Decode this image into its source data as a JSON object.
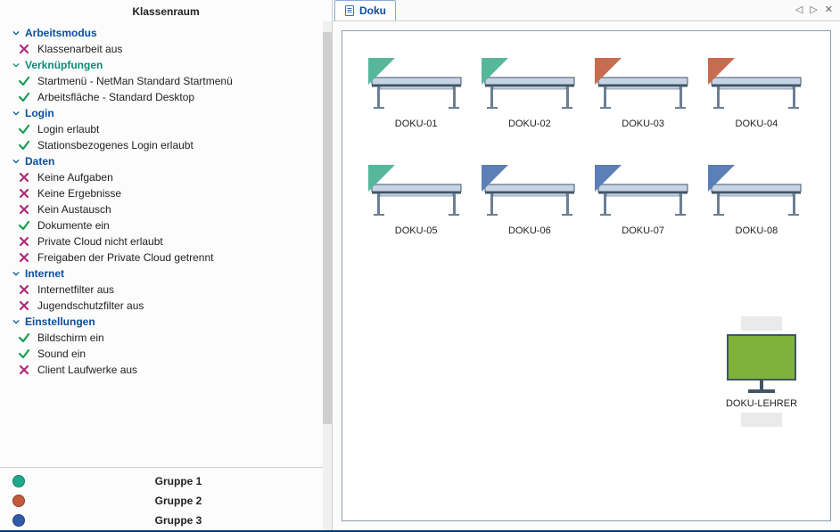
{
  "sidebar": {
    "title": "Klassenraum",
    "sections": [
      {
        "name": "Arbeitsmodus",
        "color": "blue",
        "items": [
          {
            "status": "off",
            "label": "Klassenarbeit aus"
          }
        ]
      },
      {
        "name": "Verknüpfungen",
        "color": "green",
        "items": [
          {
            "status": "on",
            "label": "Startmenü - NetMan Standard Startmenü"
          },
          {
            "status": "on",
            "label": "Arbeitsfläche - Standard Desktop"
          }
        ]
      },
      {
        "name": "Login",
        "color": "blue",
        "items": [
          {
            "status": "on",
            "label": "Login erlaubt"
          },
          {
            "status": "on",
            "label": "Stationsbezogenes Login erlaubt"
          }
        ]
      },
      {
        "name": "Daten",
        "color": "blue",
        "items": [
          {
            "status": "off",
            "label": "Keine Aufgaben"
          },
          {
            "status": "off",
            "label": "Keine Ergebnisse"
          },
          {
            "status": "off",
            "label": "Kein Austausch"
          },
          {
            "status": "on",
            "label": "Dokumente ein"
          },
          {
            "status": "off",
            "label": "Private Cloud nicht erlaubt"
          },
          {
            "status": "off",
            "label": "Freigaben der Private Cloud getrennt"
          }
        ]
      },
      {
        "name": "Internet",
        "color": "blue",
        "items": [
          {
            "status": "off",
            "label": "Internetfilter aus"
          },
          {
            "status": "off",
            "label": "Jugendschutzfilter aus"
          }
        ]
      },
      {
        "name": "Einstellungen",
        "color": "blue",
        "items": [
          {
            "status": "on",
            "label": "Bildschirm ein"
          },
          {
            "status": "on",
            "label": "Sound ein"
          },
          {
            "status": "off",
            "label": "Client Laufwerke aus"
          }
        ]
      }
    ],
    "groups": [
      {
        "color": "#1fa98c",
        "label": "Gruppe 1"
      },
      {
        "color": "#c25a3c",
        "label": "Gruppe 2"
      },
      {
        "color": "#2f5aa8",
        "label": "Gruppe 3"
      }
    ]
  },
  "tabs": {
    "active": "Doku"
  },
  "stations": [
    {
      "label": "DOKU-01",
      "group": "g1"
    },
    {
      "label": "DOKU-02",
      "group": "g1"
    },
    {
      "label": "DOKU-03",
      "group": "g2"
    },
    {
      "label": "DOKU-04",
      "group": "g2"
    },
    {
      "label": "DOKU-05",
      "group": "g1"
    },
    {
      "label": "DOKU-06",
      "group": "g3"
    },
    {
      "label": "DOKU-07",
      "group": "g3"
    },
    {
      "label": "DOKU-08",
      "group": "g3"
    }
  ],
  "teacher": {
    "label": "DOKU-LEHRER"
  },
  "colors": {
    "g1": "#57b79b",
    "g2": "#c86b4f",
    "g3": "#5d7fb8",
    "deskTop": "#c7d4e6",
    "deskEdge": "#415568",
    "deskLeg": "#6b7f95"
  }
}
